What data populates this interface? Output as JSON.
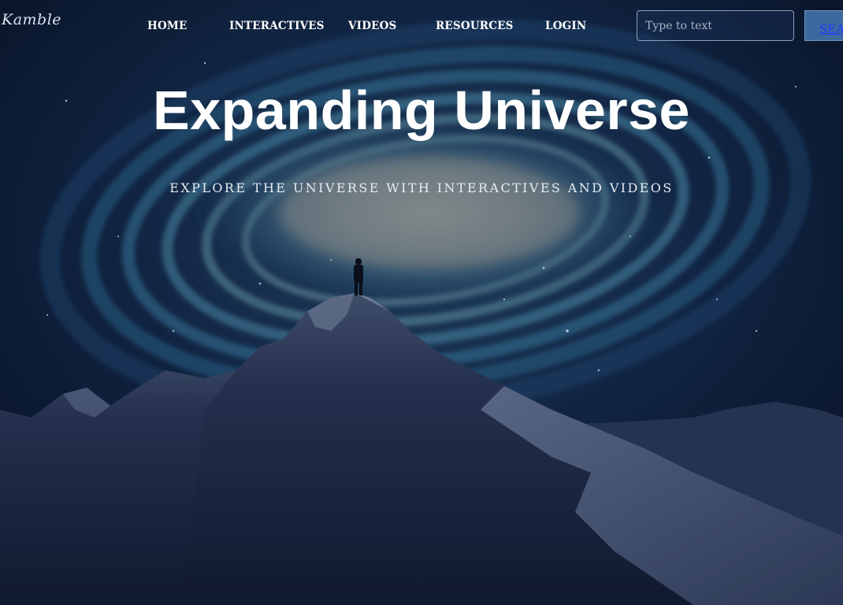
{
  "header": {
    "logo_text": "Kamble",
    "nav": [
      {
        "label": "HOME"
      },
      {
        "label": "INTERACTIVES"
      },
      {
        "label": "VIDEOS"
      },
      {
        "label": "RESOURCES"
      },
      {
        "label": "LOGIN"
      }
    ],
    "search": {
      "placeholder": "Type to text",
      "value": "",
      "button_label": "SEARCH"
    }
  },
  "hero": {
    "title": "Expanding Universe",
    "subtitle": "EXPLORE THE UNIVERSE WITH INTERACTIVES AND VIDEOS",
    "background": "galaxy-spiral-over-snowy-mountain-with-lone-figure"
  },
  "colors": {
    "sky_dark": "#0a1428",
    "galaxy_core": "#8a9aa0",
    "galaxy_arm": "#3f7fa6",
    "mountain": "#1a2540",
    "snow": "#8a99b4",
    "search_button_bg": "#3d6a9e",
    "link_blue": "#1a3cff"
  }
}
